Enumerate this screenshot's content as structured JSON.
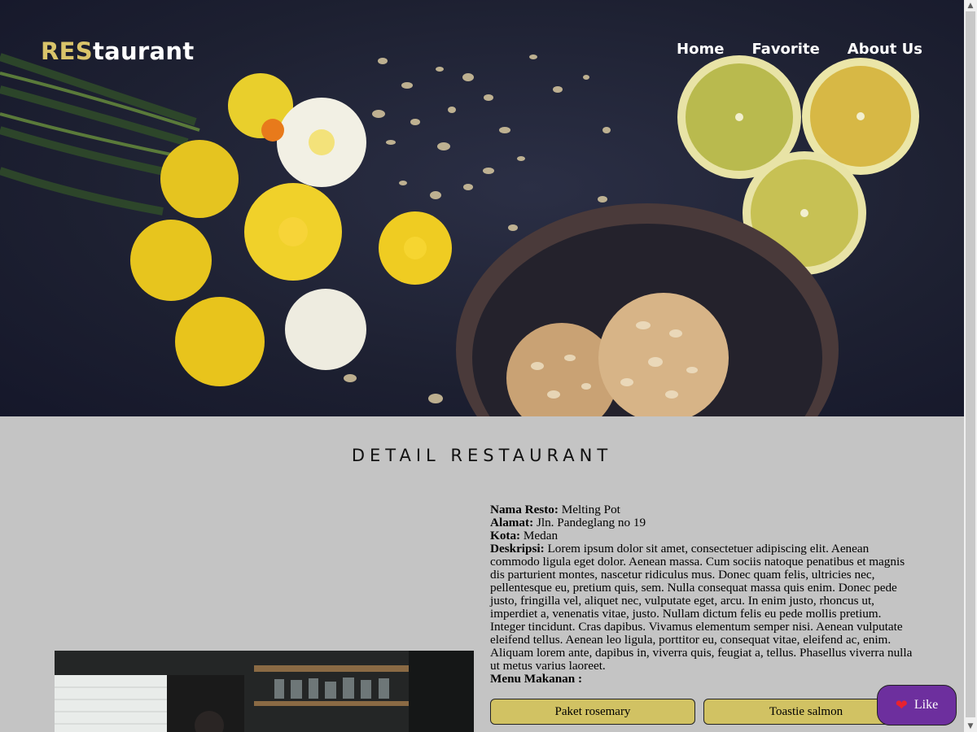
{
  "header": {
    "brand_accent": "RES",
    "brand_rest": "taurant",
    "nav": [
      {
        "label": "Home"
      },
      {
        "label": "Favorite"
      },
      {
        "label": "About Us"
      }
    ]
  },
  "detail": {
    "title": "DETAIL RESTAURANT",
    "name_label": "Nama Resto:",
    "name": "Melting Pot",
    "address_label": "Alamat:",
    "address": "Jln. Pandeglang no 19",
    "city_label": "Kota:",
    "city": "Medan",
    "description_label": "Deskripsi:",
    "description": "Lorem ipsum dolor sit amet, consectetuer adipiscing elit. Aenean commodo ligula eget dolor. Aenean massa. Cum sociis natoque penatibus et magnis dis parturient montes, nascetur ridiculus mus. Donec quam felis, ultricies nec, pellentesque eu, pretium quis, sem. Nulla consequat massa quis enim. Donec pede justo, fringilla vel, aliquet nec, vulputate eget, arcu. In enim justo, rhoncus ut, imperdiet a, venenatis vitae, justo. Nullam dictum felis eu pede mollis pretium. Integer tincidunt. Cras dapibus. Vivamus elementum semper nisi. Aenean vulputate eleifend tellus. Aenean leo ligula, porttitor eu, consequat vitae, eleifend ac, enim. Aliquam lorem ante, dapibus in, viverra quis, feugiat a, tellus. Phasellus viverra nulla ut metus varius laoreet.",
    "menu_label": "Menu Makanan :",
    "menu_items": [
      "Paket rosemary",
      "Toastie salmon"
    ]
  },
  "like_button": {
    "label": "Like",
    "icon": "heart-icon"
  },
  "colors": {
    "accent": "#d9c46a",
    "menu_button": "#d1c263",
    "like_button": "#6d2f9e",
    "page_background": "#c4c4c4"
  }
}
